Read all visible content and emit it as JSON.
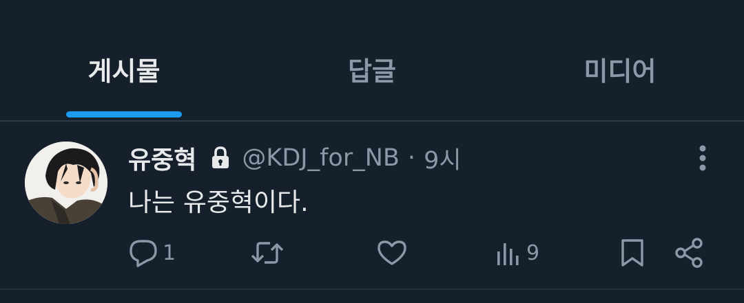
{
  "tabs": {
    "posts": "게시물",
    "replies": "답글",
    "media": "미디어"
  },
  "tweet": {
    "display_name": "유중혁",
    "protected_icon": "lock-icon",
    "handle": "@KDJ_for_NB",
    "separator": "·",
    "time": "9시",
    "text": "나는 유중혁이다.",
    "more_icon": "more-vertical-icon"
  },
  "actions": {
    "reply_count": "1",
    "retweet_count": "",
    "like_count": "",
    "views_count": "9"
  },
  "colors": {
    "background": "#16202c",
    "accent": "#1d9bf0",
    "text_primary": "#e7e9ea",
    "text_secondary": "#8b98a5"
  }
}
